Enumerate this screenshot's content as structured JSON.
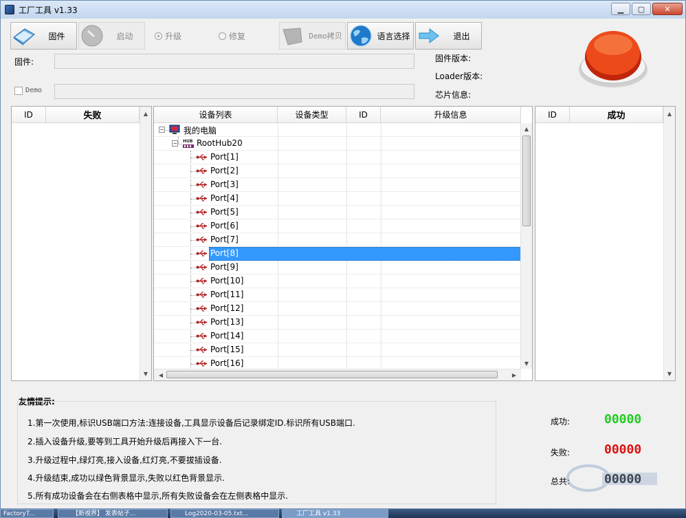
{
  "window": {
    "title": "工厂工具 v1.33"
  },
  "toolbar": {
    "firmware_label": "固件",
    "start_label": "启动",
    "upgrade_label": "升级",
    "repair_label": "修复",
    "demo_copy_label": "Demo拷贝",
    "language_label": "语言选择",
    "exit_label": "退出"
  },
  "form": {
    "firmware_label": "固件:",
    "firmware_value": "",
    "demo_label": "Demo",
    "demo_value": ""
  },
  "info": {
    "firmware_version_label": "固件版本:",
    "loader_version_label": "Loader版本:",
    "chip_info_label": "芯片信息:"
  },
  "fail_table": {
    "col_id": "ID",
    "col_status": "失败"
  },
  "success_table": {
    "col_id": "ID",
    "col_status": "成功"
  },
  "device_tree": {
    "columns": [
      "设备列表",
      "设备类型",
      "ID",
      "升级信息"
    ],
    "root": "我的电脑",
    "hub": "RootHub20",
    "ports": [
      "Port[1]",
      "Port[2]",
      "Port[3]",
      "Port[4]",
      "Port[5]",
      "Port[6]",
      "Port[7]",
      "Port[8]",
      "Port[9]",
      "Port[10]",
      "Port[11]",
      "Port[12]",
      "Port[13]",
      "Port[14]",
      "Port[15]",
      "Port[16]"
    ],
    "selected": "Port[8]"
  },
  "tips": {
    "title": "友情提示:",
    "items": [
      "1.第一次使用,标识USB端口方法:连接设备,工具显示设备后记录绑定ID.标识所有USB端口.",
      "2.插入设备升级,要等到工具开始升级后再接入下一台.",
      "3.升级过程中,绿灯亮,接入设备,红灯亮,不要拔插设备.",
      "4.升级结束,成功以绿色背景显示,失败以红色背景显示.",
      "5.所有成功设备会在右侧表格中显示,所有失败设备会在左侧表格中显示."
    ]
  },
  "stats": {
    "success_label": "成功:",
    "success_value": "00000",
    "fail_label": "失败:",
    "fail_value": "00000",
    "total_label": "总共:",
    "total_value": "00000",
    "success_color": "#22cc22",
    "fail_color": "#dd1111",
    "total_color": "#111111"
  },
  "taskbar": {
    "items": [
      "FactoryT...",
      "【新視界】 发表帖子...",
      "Log2020-03-05.txt...",
      "工厂工具 v1.33"
    ]
  }
}
